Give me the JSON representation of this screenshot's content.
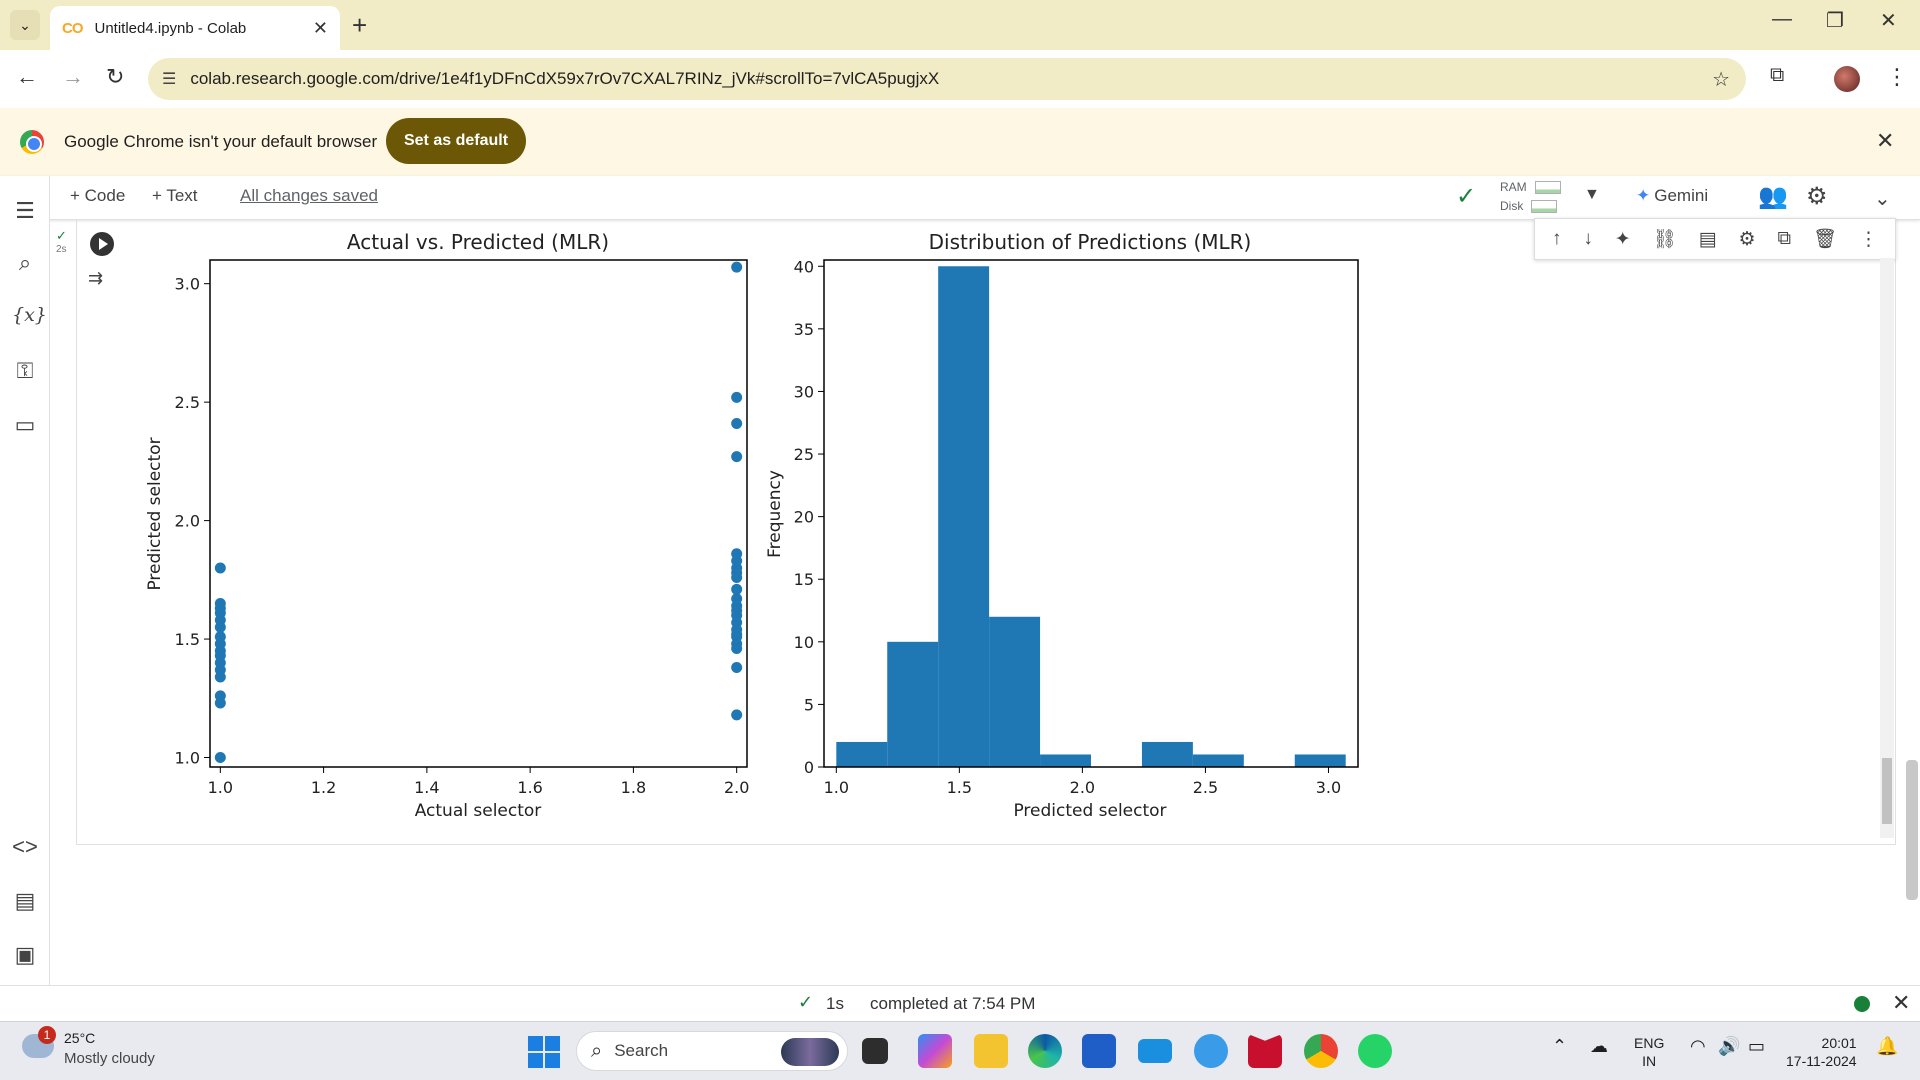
{
  "browser": {
    "tab_title": "Untitled4.ipynb - Colab",
    "url": "colab.research.google.com/drive/1e4f1yDFnCdX59x7rOv7CXAL7RINz_jVk#scrollTo=7vlCA5pugjxX",
    "infobar_message": "Google Chrome isn't your default browser",
    "set_default_label": "Set as default"
  },
  "colab": {
    "add_code": "+ Code",
    "add_text": "+ Text",
    "saved_status": "All changes saved",
    "ram_label": "RAM",
    "disk_label": "Disk",
    "gemini_label": "Gemini",
    "cell_exec_time": "2s"
  },
  "charts": {
    "left_title": "Actual vs. Predicted (MLR)",
    "left_xlabel": "Actual selector",
    "left_ylabel": "Predicted selector",
    "left_xticks": [
      "1.0",
      "1.2",
      "1.4",
      "1.6",
      "1.8",
      "2.0"
    ],
    "left_yticks": [
      "1.0",
      "1.5",
      "2.0",
      "2.5",
      "3.0"
    ],
    "right_title": "Distribution of Predictions (MLR)",
    "right_xlabel": "Predicted selector",
    "right_ylabel": "Frequency",
    "right_xticks": [
      "1.0",
      "1.5",
      "2.0",
      "2.5",
      "3.0"
    ],
    "right_yticks": [
      "0",
      "5",
      "10",
      "15",
      "20",
      "25",
      "30",
      "35",
      "40"
    ]
  },
  "chart_data": [
    {
      "type": "scatter",
      "title": "Actual vs. Predicted (MLR)",
      "xlabel": "Actual selector",
      "ylabel": "Predicted selector",
      "xlim": [
        0.98,
        2.02
      ],
      "ylim": [
        0.96,
        3.1
      ],
      "color": "#1f77b4",
      "x": [
        1,
        1,
        1,
        1,
        1,
        1,
        1,
        1,
        1,
        1,
        1,
        1,
        1,
        1,
        1,
        1,
        2,
        2,
        2,
        2,
        2,
        2,
        2,
        2,
        2,
        2,
        2,
        2,
        2,
        2,
        2,
        2,
        2,
        2,
        2,
        2,
        2,
        2
      ],
      "y": [
        1.0,
        1.23,
        1.26,
        1.34,
        1.37,
        1.4,
        1.43,
        1.45,
        1.48,
        1.51,
        1.55,
        1.58,
        1.61,
        1.63,
        1.65,
        1.8,
        1.18,
        1.38,
        1.46,
        1.48,
        1.51,
        1.54,
        1.57,
        1.6,
        1.62,
        1.64,
        1.67,
        1.71,
        1.76,
        1.78,
        1.8,
        1.83,
        1.86,
        2.27,
        2.41,
        2.52,
        3.07,
        1.52
      ]
    },
    {
      "type": "bar",
      "title": "Distribution of Predictions (MLR)",
      "xlabel": "Predicted selector",
      "ylabel": "Frequency",
      "color": "#1f77b4",
      "xlim": [
        0.95,
        3.12
      ],
      "ylim": [
        0,
        40.5
      ],
      "bin_edges": [
        1.0,
        1.207,
        1.414,
        1.621,
        1.828,
        2.035,
        2.242,
        2.449,
        2.656,
        2.863,
        3.07
      ],
      "values": [
        2,
        10,
        40,
        12,
        1,
        0,
        2,
        1,
        0,
        1
      ]
    }
  ],
  "statusbar": {
    "duration": "1s",
    "completed": "completed at 7:54 PM"
  },
  "taskbar": {
    "weather_badge": "1",
    "temperature": "25°C",
    "weather": "Mostly cloudy",
    "search_label": "Search",
    "lang_1": "ENG",
    "lang_2": "IN",
    "time": "20:01",
    "date": "17-11-2024"
  }
}
